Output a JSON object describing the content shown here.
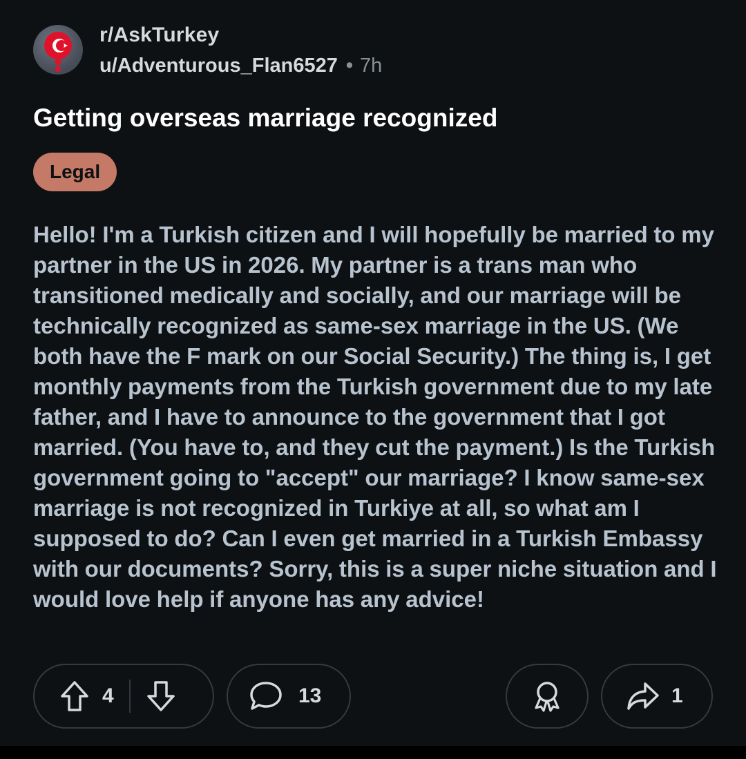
{
  "post": {
    "subreddit": "r/AskTurkey",
    "author": "u/Adventurous_Flan6527",
    "separator": "•",
    "age": "7h",
    "title": "Getting overseas marriage recognized",
    "flair": "Legal",
    "body": "Hello! I'm a Turkish citizen and I will hopefully be married to my partner in the US in 2026. My partner is a trans man who transitioned medically and socially, and our marriage will be technically recognized as same-sex marriage in the US. (We both have the F mark on our Social Security.) The thing is, I get monthly payments from the Turkish government due to my late father, and I have to announce to the government that I got married. (You have to, and they cut the payment.) Is the Turkish government going to \"accept\" our marriage? I know same-sex marriage is not recognized in Turkiye at all, so what am I supposed to do? Can I even get married in a Turkish Embassy with our documents? Sorry, this is a super niche situation and I would love help if anyone has any advice!"
  },
  "actions": {
    "vote_count": "4",
    "comment_count": "13",
    "share_count": "1"
  },
  "icons": {
    "avatar": "subreddit-avatar-turkey-question-icon",
    "upvote": "arrow-up-icon",
    "downvote": "arrow-down-icon",
    "comment": "speech-bubble-icon",
    "award": "award-ribbon-icon",
    "share": "share-arrow-icon"
  },
  "colors": {
    "background": "#0e1113",
    "flair_background": "#c47a66",
    "body_text": "#b7c3cf",
    "title_text": "#ffffff",
    "pill_border": "#343a3f"
  }
}
